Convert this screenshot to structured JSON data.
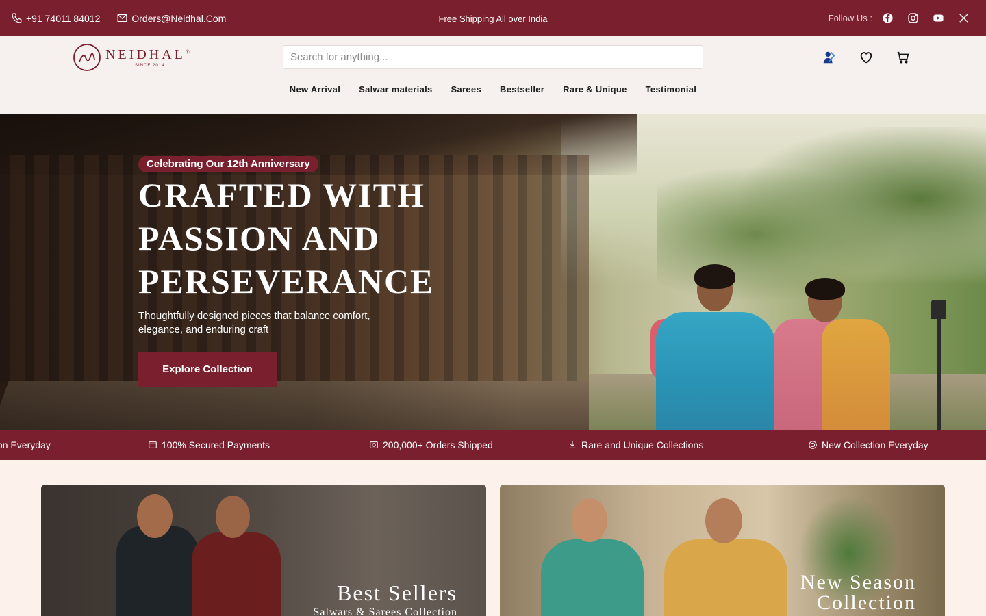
{
  "topbar": {
    "phone": "+91 74011 84012",
    "email": "Orders@Neidhal.Com",
    "shipping": "Free Shipping All over India",
    "follow_label": "Follow Us :"
  },
  "header": {
    "logo_name": "NEIDHAL",
    "logo_reg": "®",
    "logo_since": "SINCE 2014",
    "search_placeholder": "Search for anything...",
    "nav": [
      "New Arrival",
      "Salwar materials",
      "Sarees",
      "Bestseller",
      "Rare & Unique",
      "Testimonial"
    ]
  },
  "hero": {
    "badge": "Celebrating Our 12th Anniversary",
    "title": "Crafted with passion and perseverance",
    "subtitle": "Thoughtfully designed pieces that balance comfort, elegance, and enduring craft",
    "cta": "Explore Collection"
  },
  "features": [
    "on Everyday",
    "100% Secured Payments",
    "200,000+ Orders Shipped",
    "Rare and Unique Collections",
    "New Collection Everyday"
  ],
  "cards": [
    {
      "title": "Best Sellers",
      "subtitle": "Salwars & Sarees Collection"
    },
    {
      "title": "New Season Collection"
    }
  ],
  "colors": {
    "brand": "#7a1f2e",
    "header_bg": "#f6f1ee",
    "page_bg": "#fdf1ec"
  },
  "icons": [
    "phone-icon",
    "mail-icon",
    "facebook-icon",
    "instagram-icon",
    "youtube-icon",
    "x-icon",
    "account-icon",
    "heart-icon",
    "cart-icon"
  ]
}
